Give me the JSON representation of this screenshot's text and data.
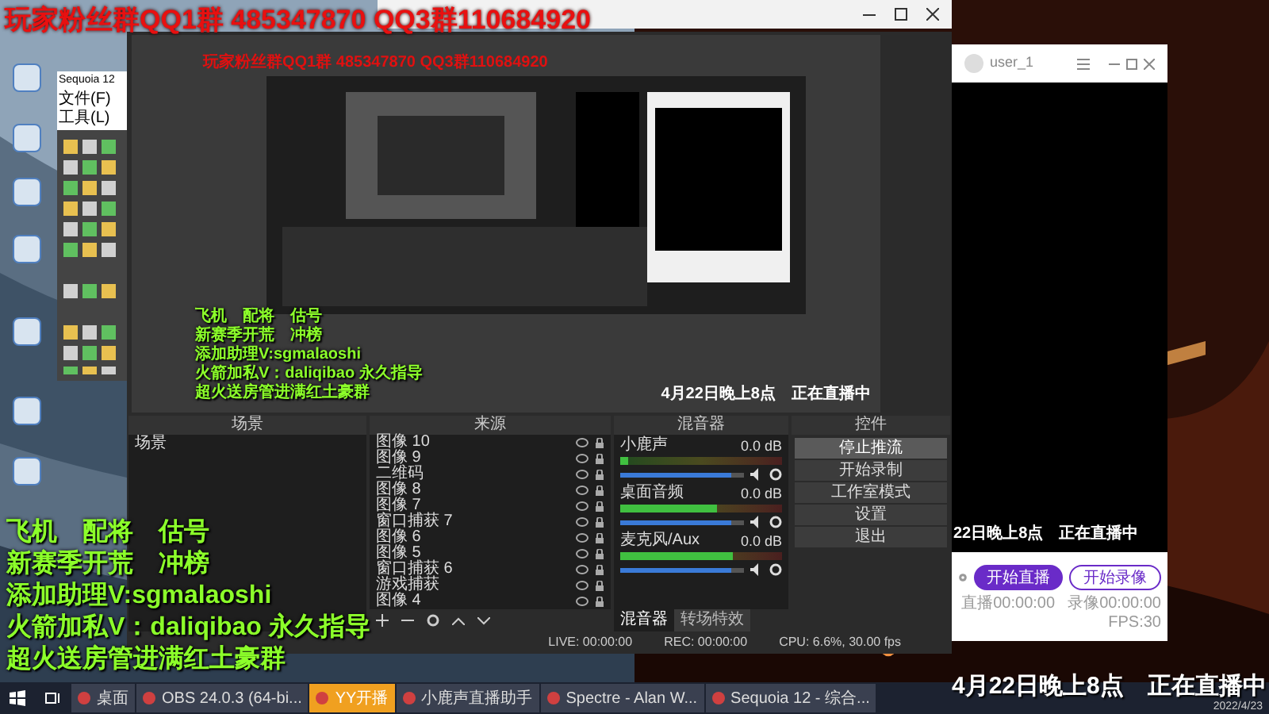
{
  "overlay": {
    "banner": "玩家粉丝群QQ1群 485347870 QQ3群110684920",
    "promo_lines": [
      "飞机　配将　估号",
      "新赛季开荒　冲榜",
      "添加助理V:sgmalaoshi",
      "火箭加私V：daliqibao 永久指导",
      "超火送房管进满红土豪群"
    ],
    "schedule": "4月22日晚上8点　正在直播中"
  },
  "sequoia_window": {
    "title": "Sequoia 12",
    "menu": [
      "文件(F)",
      "工具(L)"
    ]
  },
  "obs": {
    "preview": {
      "banner": "玩家粉丝群QQ1群 485347870 QQ3群110684920",
      "promo_lines": [
        "飞机　配将　估号",
        "新赛季开荒　冲榜",
        "添加助理V:sgmalaoshi",
        "火箭加私V：daliqibao 永久指导",
        "超火送房管进满红土豪群"
      ],
      "schedule": "4月22日晚上8点　正在直播中"
    },
    "scenes": {
      "title": "场景",
      "items": [
        {
          "label": "场景",
          "selected": false
        }
      ]
    },
    "sources": {
      "title": "来源",
      "items": [
        "图像 10",
        "图像 9",
        "二维码",
        "图像 8",
        "图像 7",
        "窗口捕获 7",
        "图像 6",
        "图像 5",
        "窗口捕获 6",
        "游戏捕获",
        "图像 4"
      ]
    },
    "mixer": {
      "title": "混音器",
      "channels": [
        {
          "name": "小鹿声",
          "reading": "0.0 dB",
          "meter": {
            "level": 0.05
          },
          "slider": {
            "level": 0.9
          }
        },
        {
          "name": "桌面音频",
          "reading": "0.0 dB",
          "meter": {
            "level": 0.6
          },
          "slider": {
            "level": 0.9
          }
        },
        {
          "name": "麦克风/Aux",
          "reading": "0.0 dB",
          "meter": {
            "level": 0.7
          },
          "slider": {
            "level": 0.9
          }
        }
      ],
      "tabs": [
        {
          "label": "混音器",
          "selected": true
        },
        {
          "label": "转场特效",
          "selected": false
        }
      ]
    },
    "controls": {
      "title": "控件",
      "buttons": [
        {
          "label": "停止推流",
          "hovered": true
        },
        {
          "label": "开始录制",
          "hovered": false
        },
        {
          "label": "工作室模式",
          "hovered": false
        },
        {
          "label": "设置",
          "hovered": false
        },
        {
          "label": "退出",
          "hovered": false
        }
      ]
    },
    "status_bar": [
      "LIVE: 00:00:00",
      "REC: 00:00:00",
      "CPU: 6.6%, 30.00 fps"
    ]
  },
  "yy_window": {
    "user": "user_1",
    "caption": "22日晚上8点　正在直播中",
    "buttons": [
      {
        "label": "开始直播",
        "kind": "primary"
      },
      {
        "label": "开始录像",
        "kind": "outline"
      }
    ],
    "stats": [
      "直播00:00:00",
      "录像00:00:00",
      "FPS:30"
    ]
  },
  "taskbar": {
    "items": [
      {
        "label": "桌面",
        "flashing": false
      },
      {
        "label": "OBS 24.0.3 (64-bi...",
        "flashing": false
      },
      {
        "label": "YY开播",
        "flashing": true
      },
      {
        "label": "小鹿声直播助手",
        "flashing": false
      },
      {
        "label": "Spectre - Alan W...",
        "flashing": false
      },
      {
        "label": "Sequoia 12 - 综合...",
        "flashing": false
      }
    ],
    "clock": "2022/4/23"
  }
}
